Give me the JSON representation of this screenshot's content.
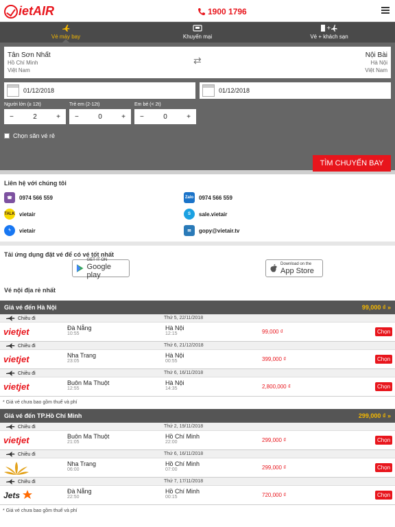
{
  "header": {
    "logo_text": "ietAIR",
    "hotline": "1900 1796"
  },
  "tabs": [
    {
      "label": "Vé máy bay",
      "active": true
    },
    {
      "label": "Khuyến mại",
      "active": false
    },
    {
      "label": "Vé + khách sạn",
      "active": false
    }
  ],
  "search": {
    "from": {
      "airport": "Tân Sơn Nhất",
      "city": "Hồ Chí Minh",
      "country": "Việt Nam"
    },
    "to": {
      "airport": "Nội Bài",
      "city": "Hà Nội",
      "country": "Việt Nam"
    },
    "depart_date": "01/12/2018",
    "return_date": "01/12/2018",
    "pax": [
      {
        "label": "Người lớn (≥ 12t)",
        "value": "2"
      },
      {
        "label": "Trẻ em (2-12t)",
        "value": "0"
      },
      {
        "label": "Em bé (< 2t)",
        "value": "0"
      }
    ],
    "cheap_label": "Chọn săn vé rẻ",
    "find_button": "TÌM CHUYẾN BAY"
  },
  "contact": {
    "title": "Liên hệ với chúng tôi",
    "viber": "0974 566 559",
    "zalo": "0974 566 559",
    "kakao": "vietair",
    "skype": "sale.vietair",
    "messenger": "vietair",
    "email": "gopy@vietair.tv"
  },
  "apps": {
    "title": "Tải ứng dụng đặt vé để có vé tốt nhất",
    "google_small": "GET IT ON",
    "google_big": "Google play",
    "apple_small": "Download on the",
    "apple_big": "App Store"
  },
  "domestic_title": "Vé nội địa rẻ nhất",
  "groups": [
    {
      "title": "Giá vé đến Hà Nội",
      "price": "99,000 ₫",
      "flights": [
        {
          "dir": "Chiều đi",
          "date": "Thứ 5, 22/11/2018",
          "airline": "vietjet",
          "from": "Đà Nẵng",
          "dep": "10:55",
          "to": "Hà Nội",
          "arr": "12:15",
          "price": "99,000 ₫",
          "btn": "Chọn"
        },
        {
          "dir": "Chiều đi",
          "date": "Thứ 6, 21/12/2018",
          "airline": "vietjet",
          "from": "Nha Trang",
          "dep": "23:05",
          "to": "Hà Nội",
          "arr": "00:55",
          "price": "399,000 ₫",
          "btn": "Chọn"
        },
        {
          "dir": "Chiều đi",
          "date": "Thứ 6, 16/11/2018",
          "airline": "vietjet",
          "from": "Buôn Ma Thuột",
          "dep": "12:55",
          "to": "Hà Nội",
          "arr": "14:35",
          "price": "2,800,000 ₫",
          "btn": "Chọn"
        }
      ],
      "note": "* Giá vé chưa bao gồm thuế và phí"
    },
    {
      "title": "Giá vé đến TP.Hồ Chí Minh",
      "price": "299,000 ₫",
      "flights": [
        {
          "dir": "Chiều đi",
          "date": "Thứ 2, 19/11/2018",
          "airline": "vietjet",
          "from": "Buôn Ma Thuột",
          "dep": "21:05",
          "to": "Hồ Chí Minh",
          "arr": "22:00",
          "price": "299,000 ₫",
          "btn": "Chọn"
        },
        {
          "dir": "Chiều đi",
          "date": "Thứ 6, 16/11/2018",
          "airline": "vietnam-airlines",
          "from": "Nha Trang",
          "dep": "06:00",
          "to": "Hồ Chí Minh",
          "arr": "07:00",
          "price": "299,000 ₫",
          "btn": "Chọn"
        },
        {
          "dir": "Chiều đi",
          "date": "Thứ 7, 17/11/2018",
          "airline": "jetstar",
          "from": "Đà Nẵng",
          "dep": "22:50",
          "to": "Hồ Chí Minh",
          "arr": "00:15",
          "price": "720,000 ₫",
          "btn": "Chọn"
        }
      ],
      "note": "* Giá vé chưa bao gồm thuế và phí"
    }
  ],
  "colors": {
    "brand_red": "#e8151c",
    "accent_yellow": "#f5b800",
    "panel_gray": "#666666"
  }
}
